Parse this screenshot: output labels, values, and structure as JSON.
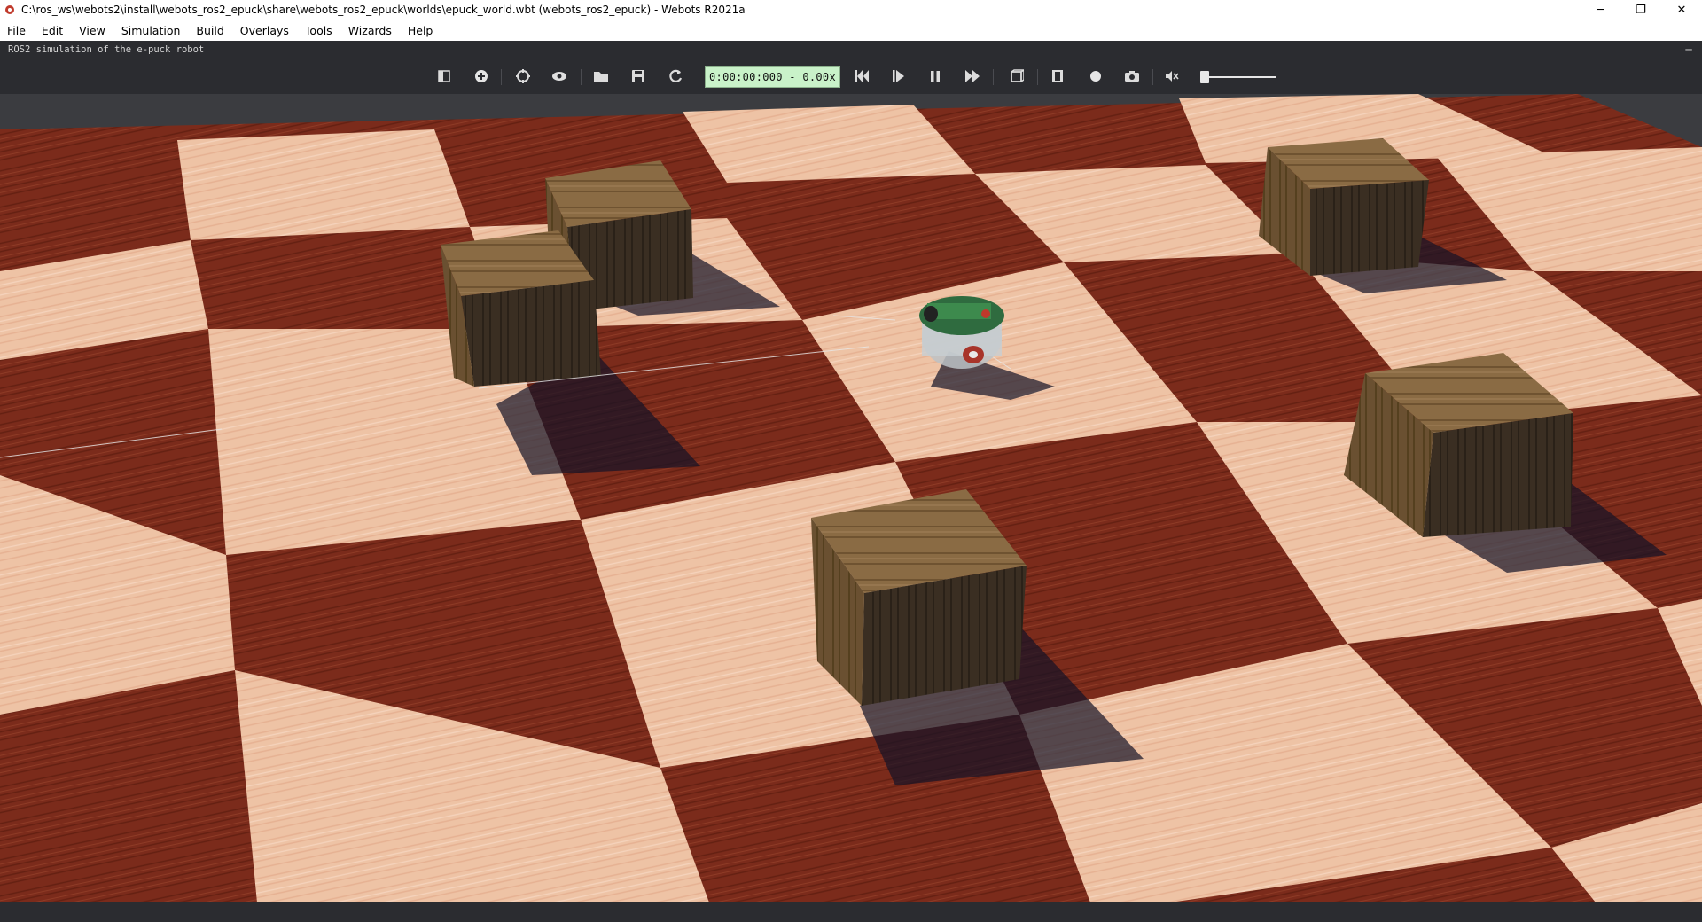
{
  "window": {
    "title": "C:\\ros_ws\\webots2\\install\\webots_ros2_epuck\\share\\webots_ros2_epuck\\worlds\\epuck_world.wbt (webots_ros2_epuck) - Webots R2021a",
    "controls": {
      "minimize": "─",
      "restore": "❐",
      "close": "✕"
    }
  },
  "menu": {
    "items": [
      {
        "label": "File"
      },
      {
        "label": "Edit"
      },
      {
        "label": "View"
      },
      {
        "label": "Simulation"
      },
      {
        "label": "Build"
      },
      {
        "label": "Overlays"
      },
      {
        "label": "Tools"
      },
      {
        "label": "Wizards"
      },
      {
        "label": "Help"
      }
    ]
  },
  "world": {
    "description": "ROS2 simulation of the e-puck robot",
    "collapse_glyph": "─"
  },
  "toolbar": {
    "time": "0:00:00:000 - 0.00x",
    "icons": [
      "scene-tree-toggle-icon",
      "add-node-icon",
      "reset-viewpoint-icon",
      "viewpoint-icon",
      "open-world-icon",
      "save-world-icon",
      "reload-world-icon",
      "reset-simulation-icon",
      "step-icon",
      "pause-icon",
      "fast-forward-icon",
      "rendering-icon",
      "movie-icon",
      "record-icon",
      "screenshot-icon",
      "mute-icon"
    ],
    "volume": 0.0
  },
  "colors": {
    "panel_bg": "#2b2c30",
    "time_bg": "#c9f2c9",
    "floor_light": "#eec4a6",
    "floor_dark": "#7a2a1b",
    "crate": "#6b5232"
  }
}
